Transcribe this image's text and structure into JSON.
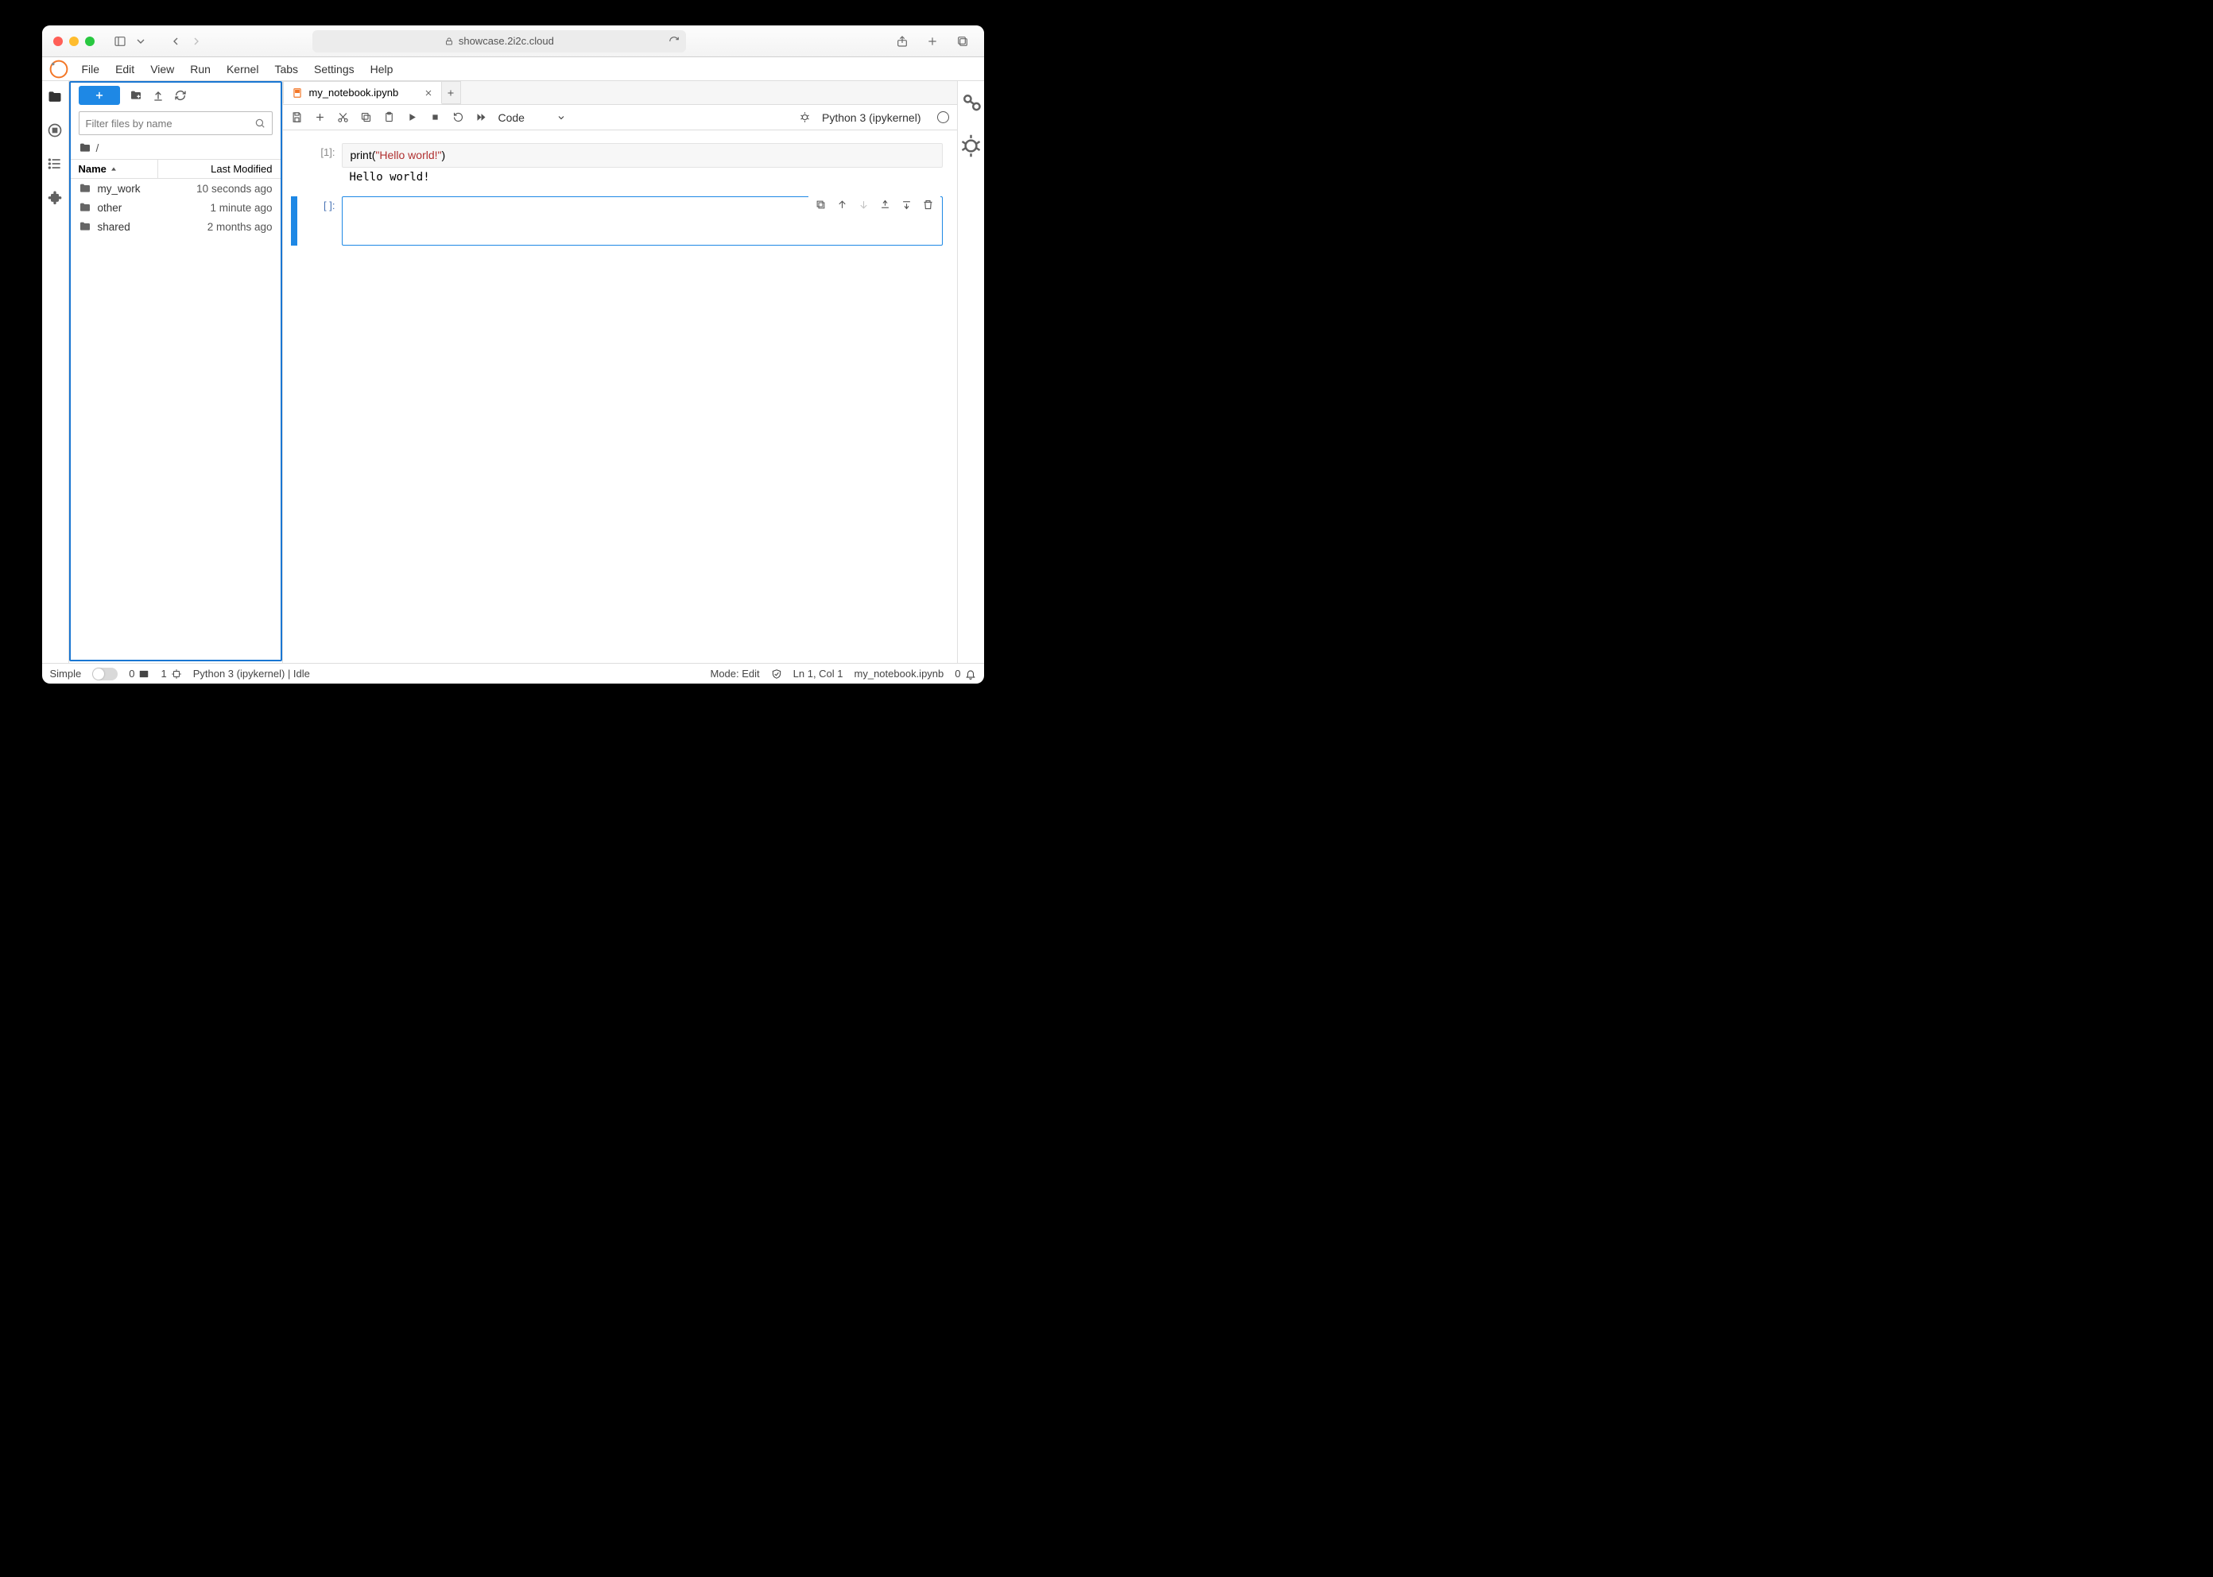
{
  "browser": {
    "url": "showcase.2i2c.cloud"
  },
  "menubar": [
    "File",
    "Edit",
    "View",
    "Run",
    "Kernel",
    "Tabs",
    "Settings",
    "Help"
  ],
  "sidebar": {
    "filter_placeholder": "Filter files by name",
    "breadcrumb": "/",
    "columns": {
      "name": "Name",
      "modified": "Last Modified"
    },
    "items": [
      {
        "name": "my_work",
        "modified": "10 seconds ago"
      },
      {
        "name": "other",
        "modified": "1 minute ago"
      },
      {
        "name": "shared",
        "modified": "2 months ago"
      }
    ]
  },
  "tab": {
    "title": "my_notebook.ipynb"
  },
  "notebook": {
    "cell_type_selector": "Code",
    "kernel_name": "Python 3 (ipykernel)",
    "cells": [
      {
        "prompt": "[1]:",
        "code_prefix": "print(",
        "code_string": "\"Hello world!\"",
        "code_suffix": ")",
        "output": "Hello world!"
      },
      {
        "prompt": "[ ]:",
        "active": true
      }
    ]
  },
  "status": {
    "simple": "Simple",
    "tabs_count": "0",
    "terminals_count": "1",
    "kernel": "Python 3 (ipykernel) | Idle",
    "mode": "Mode: Edit",
    "cursor": "Ln 1, Col 1",
    "doc": "my_notebook.ipynb",
    "notif_count": "0"
  }
}
